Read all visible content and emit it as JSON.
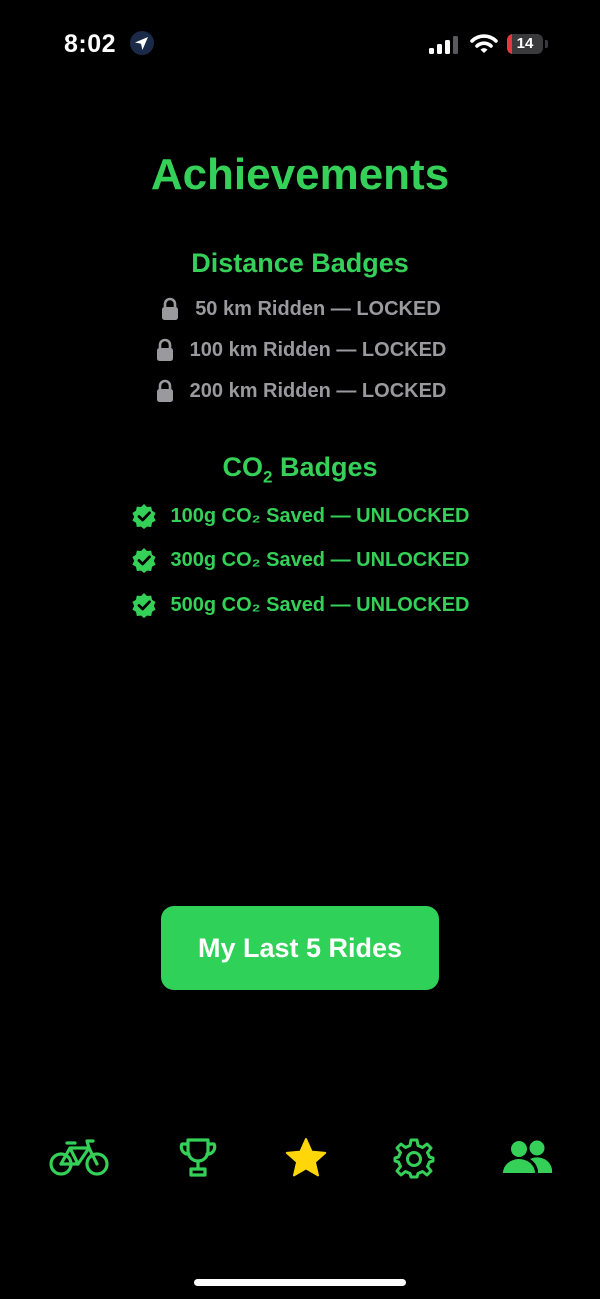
{
  "status_bar": {
    "time": "8:02",
    "battery_level": "14",
    "battery_fraction": 0.14,
    "colors": {
      "battery_low": "#e5383b"
    }
  },
  "page": {
    "title": "Achievements"
  },
  "distance_badges": {
    "title": "Distance Badges",
    "items": [
      {
        "label": "50 km Ridden — LOCKED",
        "icon": "lock-icon",
        "state": "locked"
      },
      {
        "label": "100 km Ridden — LOCKED",
        "icon": "lock-icon",
        "state": "locked"
      },
      {
        "label": "200 km Ridden — LOCKED",
        "icon": "lock-icon",
        "state": "locked"
      }
    ]
  },
  "co2_badges": {
    "title_prefix": "CO",
    "title_sub": "2",
    "title_suffix": " Badges",
    "items": [
      {
        "label": "100g CO₂ Saved — UNLOCKED",
        "icon": "verified-check-icon",
        "state": "unlocked"
      },
      {
        "label": "300g CO₂ Saved — UNLOCKED",
        "icon": "verified-check-icon",
        "state": "unlocked"
      },
      {
        "label": "500g CO₂ Saved — UNLOCKED",
        "icon": "verified-check-icon",
        "state": "unlocked"
      }
    ]
  },
  "actions": {
    "last_rides_label": "My Last 5 Rides"
  },
  "tab_bar": {
    "tabs": [
      {
        "name": "bike",
        "icon": "bicycle-icon",
        "active": false
      },
      {
        "name": "leaderboard",
        "icon": "trophy-icon",
        "active": false
      },
      {
        "name": "achievements",
        "icon": "star-icon",
        "active": true
      },
      {
        "name": "settings",
        "icon": "gear-icon",
        "active": false
      },
      {
        "name": "friends",
        "icon": "people-icon",
        "active": false
      }
    ]
  },
  "colors": {
    "accent_green": "#34d058",
    "button_green": "#30d158",
    "locked_gray": "#9a9a9e",
    "active_star": "#ffd60a",
    "background": "#000000"
  }
}
